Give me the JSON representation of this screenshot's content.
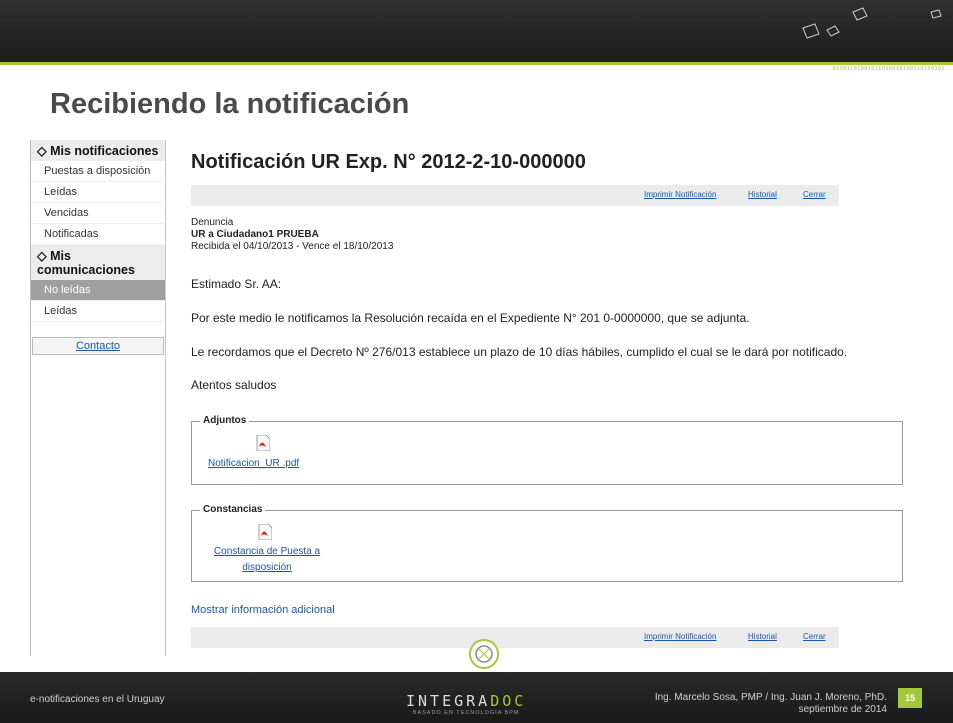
{
  "slide": {
    "title": "Recibiendo la notificación",
    "footer_left": "e-notificaciones en el Uruguay",
    "brand_prefix": "INTEGRA",
    "brand_suffix": "DOC",
    "brand_tagline": "BASADO EN TECNOLOGÍA BPM",
    "footer_right_line1": "Ing. Marcelo Sosa, PMP / Ing. Juan J. Moreno, PhD.",
    "footer_right_line2": "septiembre de 2014",
    "page_number": "15"
  },
  "sidebar": {
    "section1": "◇ Mis notificaciones",
    "items1": [
      "Puestas a disposición",
      "Leídas",
      "Vencidas",
      "Notificadas"
    ],
    "section2": "◇ Mis comunicaciones",
    "items2": [
      "No leídas",
      "Leídas"
    ],
    "active_item": "No leídas",
    "contact": "Contacto"
  },
  "notification": {
    "title": "Notificación UR Exp. N° 2012-2-10-000000",
    "toolbar": {
      "print": "Imprimir Notificación",
      "history": "Historial",
      "close": "Cerrar"
    },
    "type": "Denuncia",
    "sender": "UR        a Ciudadano1 PRUEBA",
    "dates": "Recibida el 04/10/2013 - Vence el 18/10/2013",
    "greeting": "Estimado Sr. AA:",
    "body1": "Por este medio  le notificamos la Resolución recaída en el Expediente N° 201          0-0000000, que se adjunta.",
    "body2": "Le recordamos que el Decreto Nº 276/013 establece un plazo de 10 días hábiles, cumplido el cual se le dará por notificado.",
    "closing": "Atentos saludos",
    "attachments_label": "Adjuntos",
    "attachment_file": "Notificacion_UR      .pdf",
    "constancias_label": "Constancias",
    "constancia_file_line1": "Constancia de Puesta a",
    "constancia_file_line2": "disposición",
    "more_info": "Mostrar información adicional"
  },
  "colors": {
    "accent": "#a7c73a",
    "link": "#1a56b0",
    "dark": "#1c1c1c"
  }
}
